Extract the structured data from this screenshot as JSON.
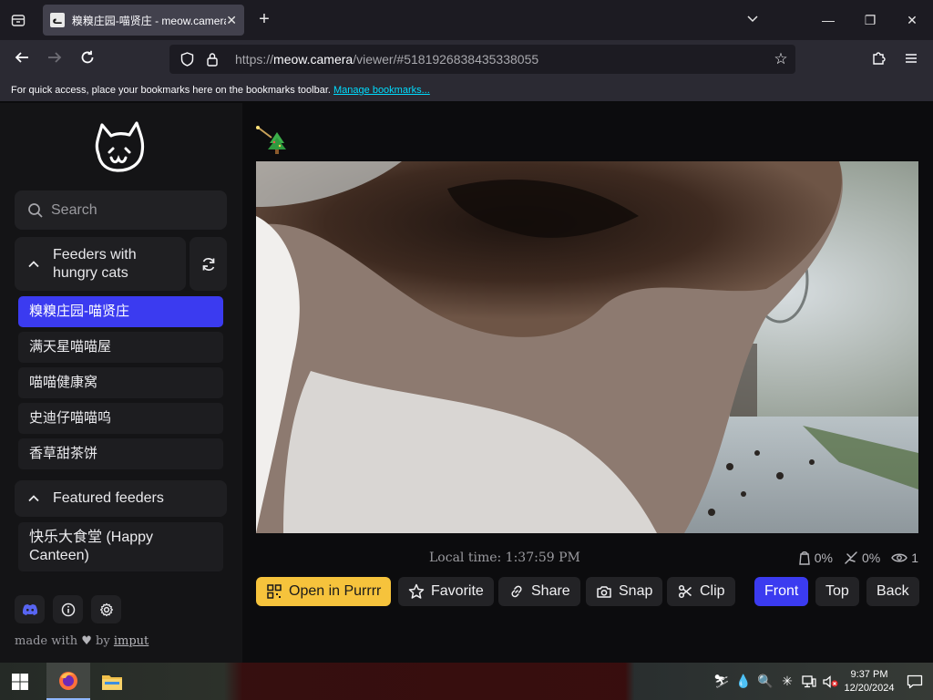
{
  "browser": {
    "tab_title": "糗糗庄园-喵贤庄 - meow.camera",
    "url_prefix": "https://",
    "url_host": "meow.camera",
    "url_path": "/viewer/#5181926838435338055",
    "bookmarks_msg": "For quick access, place your bookmarks here on the bookmarks toolbar.",
    "bookmarks_link": "Manage bookmarks..."
  },
  "sidebar": {
    "search_placeholder": "Search",
    "section1_label": "Feeders with hungry cats",
    "feeders": [
      "糗糗庄园-喵贤庄",
      "满天星喵喵屋",
      "喵喵健康窝",
      "史迪仔喵喵呜",
      "香草甜茶饼"
    ],
    "active_feeder_index": 0,
    "section2_label": "Featured feeders",
    "featured": [
      "快乐大食堂 (Happy Canteen)"
    ],
    "footer_prefix": "made with",
    "footer_by": "by",
    "footer_author": "imput"
  },
  "viewer": {
    "local_time": "Local time: 1:37:59 PM",
    "food_pct": "0%",
    "water_pct": "0%",
    "viewers": "1",
    "actions": {
      "open": "Open in Purrrr",
      "favorite": "Favorite",
      "share": "Share",
      "snap": "Snap",
      "clip": "Clip",
      "front": "Front",
      "top": "Top",
      "back": "Back"
    }
  },
  "taskbar": {
    "time": "9:37 PM",
    "date": "12/20/2024"
  },
  "colors": {
    "accent_blue": "#3b3bf0",
    "accent_yellow": "#f6c33c",
    "link_cyan": "#00ddff"
  }
}
